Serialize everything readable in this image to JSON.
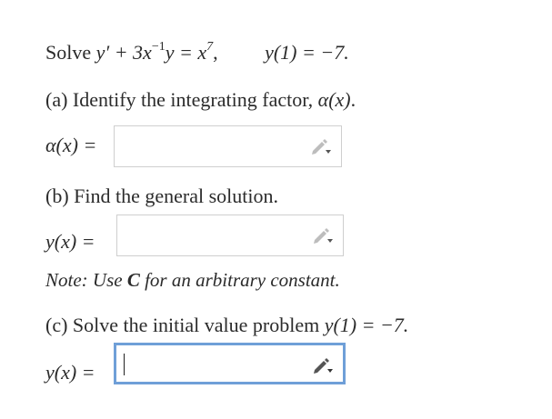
{
  "problem": {
    "solve_word": "Solve",
    "equation_lhs_a": "y′ + 3x",
    "equation_lhs_exp": "−1",
    "equation_lhs_b": "y = x",
    "equation_rhs_exp": "7",
    "equation_tail": ",",
    "initial_condition": "y(1) = −7."
  },
  "part_a": {
    "prompt_text": "(a) Identify the integrating factor, ",
    "prompt_math": "α(x)",
    "prompt_end": ".",
    "answer_label": "α(x) ="
  },
  "part_b": {
    "prompt_text": "(b) Find the general solution.",
    "answer_label": "y(x) =",
    "note_prefix": "Note: Use ",
    "note_symbol": "C",
    "note_suffix": " for an arbitrary constant."
  },
  "part_c": {
    "prompt_text": "(c) Solve the initial value problem ",
    "prompt_math": "y(1) = −7.",
    "answer_label": "y(x) ="
  },
  "icons": {
    "edit": "pencil-icon"
  },
  "colors": {
    "active_border": "#6f9fd8",
    "box_border": "#cfcfcf",
    "text": "#2b2b2b"
  }
}
